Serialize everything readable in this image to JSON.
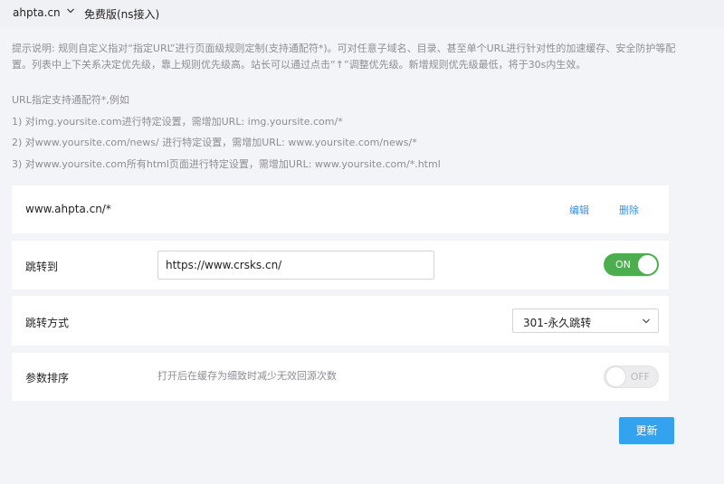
{
  "header": {
    "domain": "ahpta.cn",
    "plan": "免费版(ns接入)"
  },
  "notes": {
    "desc_line1": "提示说明: 规则自定义指对“指定URL”进行页面级规则定制(支持通配符*)。可对任意子域名、目录、甚至单个URL进行针对性的加速缓存、安全防护等配",
    "desc_line2": "置。列表中上下关系决定优先级，靠上规则优先级高。站长可以通过点击“↑”调整优先级。新增规则优先级最低，将于30s内生效。",
    "example_title": "URL指定支持通配符*,例如",
    "example_1": "1) 对img.yoursite.com进行特定设置，需增加URL: img.yoursite.com/*",
    "example_2": "2) 对www.yoursite.com/news/ 进行特定设置，需增加URL: www.yoursite.com/news/*",
    "example_3": "3) 对www.yoursite.com所有html页面进行特定设置，需增加URL: www.yoursite.com/*.html"
  },
  "rule": {
    "path": "www.ahpta.cn/*",
    "edit_label": "编辑",
    "delete_label": "删除"
  },
  "redirect": {
    "label": "跳转到",
    "url": "https://www.crsks.cn/",
    "toggle_state": "ON"
  },
  "method": {
    "label": "跳转方式",
    "selected": "301-永久跳转"
  },
  "params": {
    "label": "参数排序",
    "hint": "打开后在缓存为细致时减少无效回源次数",
    "toggle_state": "OFF"
  },
  "actions": {
    "save_label": "更新"
  },
  "colors": {
    "accent": "#33a2ef",
    "link": "#3c8ee8",
    "toggle_on": "#4cae4f"
  }
}
